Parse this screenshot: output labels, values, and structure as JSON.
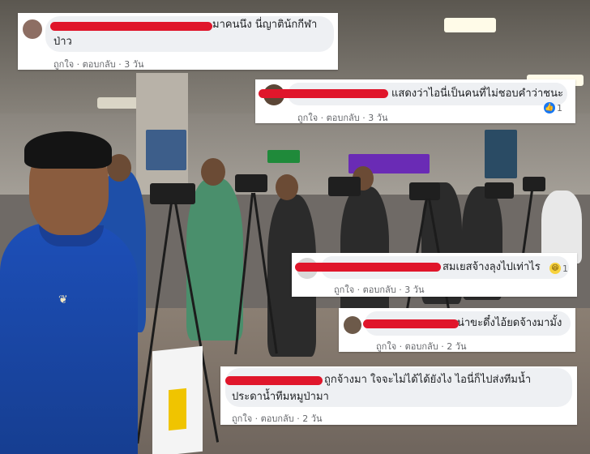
{
  "actions": {
    "like": "ถูกใจ",
    "reply": "ตอบกลับ",
    "sep": "·"
  },
  "comments": [
    {
      "text_line1": "มาคนนึง นี่ญาติน้กกีฬา",
      "text_line2": "ป่าว",
      "time": "3 วัน"
    },
    {
      "text_line1": "แสดงว่าไอนี่เป็นคนที่ไม่ชอบคำว่าชนะ",
      "time": "3 วัน",
      "reaction_count": "1",
      "reaction": "like-icon"
    },
    {
      "text_line1": "สมเยสจ้างลุงไปเท่าไร",
      "time": "3 วัน",
      "reaction_count": "1",
      "reaction": "haha-icon"
    },
    {
      "text_line1": "น่าขะดึ๋งไอ้ยดจ้างมามั้ง",
      "time": "2 วัน"
    },
    {
      "text_line1": "ถูกจ้างมา ใจจะไม่ได้ได้ยังไง ไอนี่ก็ไปส่งทีมน้ำ",
      "text_line2": "ประดาน้ำทีมหมูป่ามา",
      "time": "2 วัน"
    }
  ],
  "colors": {
    "redaction": "#e0162b",
    "bubble": "#eef0f3",
    "like_blue": "#1877f2"
  }
}
